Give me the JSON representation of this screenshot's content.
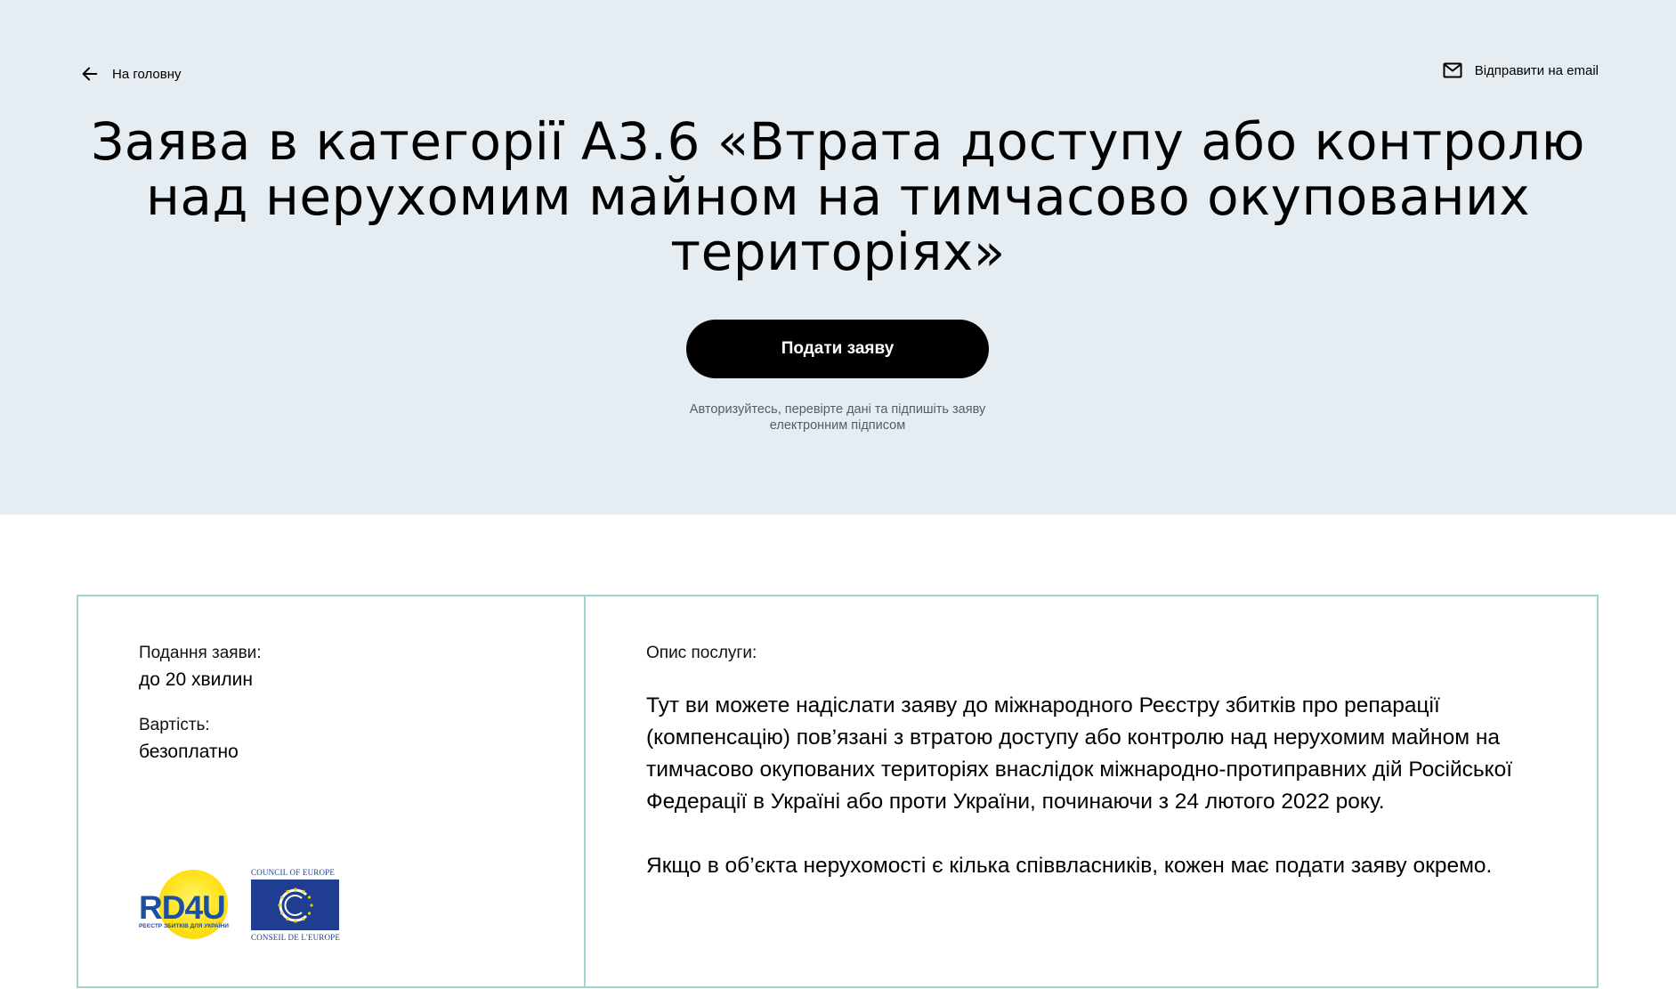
{
  "header": {
    "back_label": "На головну",
    "email_label": "Відправити на email"
  },
  "hero": {
    "title": "Заява в категорії А3.6 «Втрата доступу або контролю над нерухомим майном на тимчасово окупованих територіях»",
    "cta_label": "Подати заяву",
    "cta_hint": "Авторизуйтесь, перевірте дані та підпишіть заяву електронним підписом"
  },
  "info": {
    "submission_label": "Подання заяви:",
    "submission_value": "до 20 хвилин",
    "cost_label": "Вартість:",
    "cost_value": "безоплатно",
    "description_label": "Опис послуги:",
    "description_paragraphs": [
      "Тут ви можете надіслати заяву до міжнародного Реєстру збитків про репарації (компенсацію) пов’язані з втратою доступу або контролю над нерухомим майном на тимчасово окупованих територіях внаслідок міжнародно-протиправних дій Російської Федерації в Україні або проти України, починаючи з 24 лютого 2022 року.",
      "Якщо в об’єкта нерухомості є кілька співвласників, кожен має подати заяву окремо."
    ]
  },
  "logos": {
    "rd4u_text": "RD4U",
    "rd4u_subtitle": "РЕЄСТР ЗБИТКІВ ДЛЯ УКРАЇНИ",
    "coe_top": "COUNCIL OF EUROPE",
    "coe_bottom": "CONSEIL DE L'EUROPE"
  },
  "colors": {
    "hero_bg": "#e5ecf2",
    "card_border": "#9dd3d1",
    "coe_blue": "#1f3e91",
    "rd4u_blue": "#1b4fa3",
    "rd4u_yellow": "#ffe21a"
  },
  "icons": {
    "back": "arrow-left-icon",
    "email": "mail-icon"
  }
}
